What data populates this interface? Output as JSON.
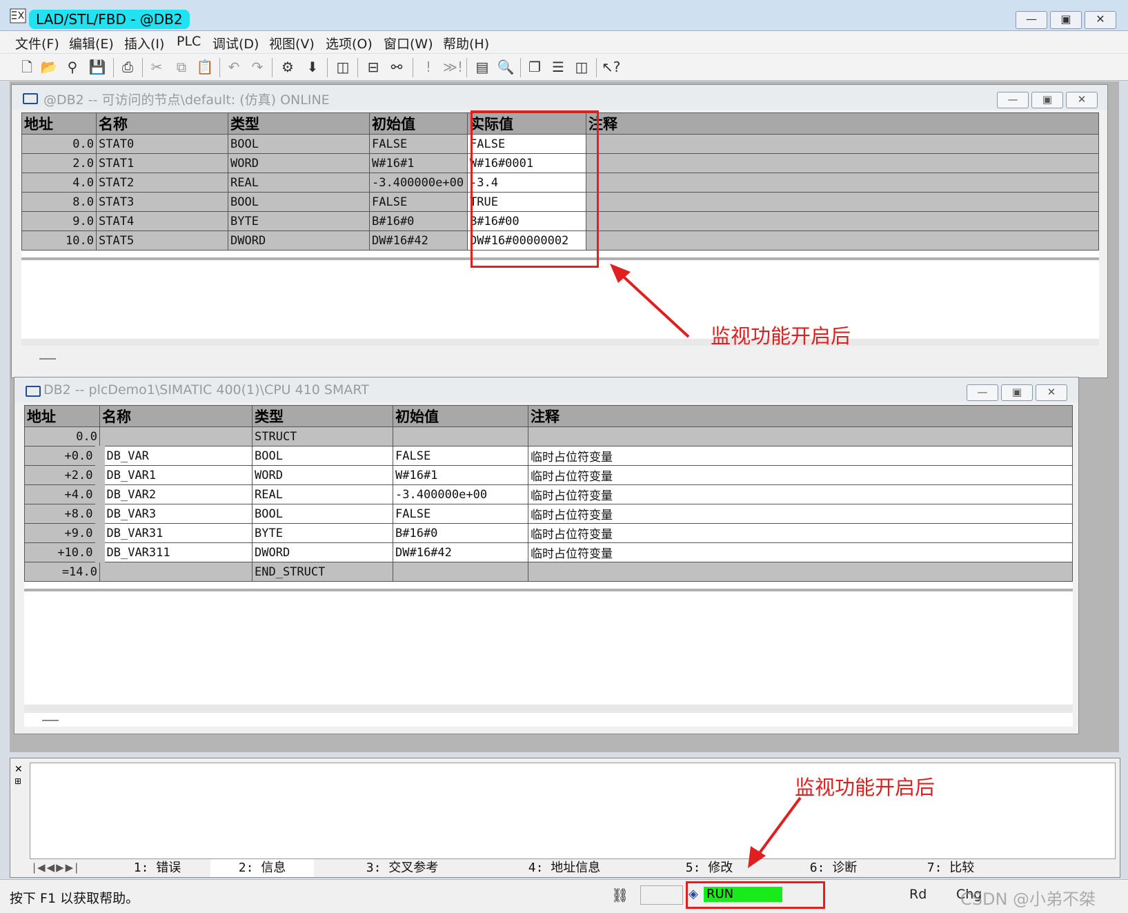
{
  "app": {
    "title": "LAD/STL/FBD  - @DB2"
  },
  "menu": [
    "文件(F)",
    "编辑(E)",
    "插入(I)",
    "PLC",
    "调试(D)",
    "视图(V)",
    "选项(O)",
    "窗口(W)",
    "帮助(H)"
  ],
  "online_window": {
    "title": "@DB2 -- 可访问的节点\\default:  (仿真)  ONLINE",
    "headers": [
      "地址",
      "名称",
      "类型",
      "初始值",
      "实际值",
      "注释"
    ],
    "rows": [
      {
        "addr": "0.0",
        "name": "STAT0",
        "type": "BOOL",
        "init": "FALSE",
        "actual": "FALSE"
      },
      {
        "addr": "2.0",
        "name": "STAT1",
        "type": "WORD",
        "init": "W#16#1",
        "actual": "W#16#0001"
      },
      {
        "addr": "4.0",
        "name": "STAT2",
        "type": "REAL",
        "init": "-3.400000e+00",
        "actual": "-3.4"
      },
      {
        "addr": "8.0",
        "name": "STAT3",
        "type": "BOOL",
        "init": "FALSE",
        "actual": "TRUE"
      },
      {
        "addr": "9.0",
        "name": "STAT4",
        "type": "BYTE",
        "init": "B#16#0",
        "actual": "B#16#00"
      },
      {
        "addr": "10.0",
        "name": "STAT5",
        "type": "DWORD",
        "init": "DW#16#42",
        "actual": "DW#16#00000002"
      }
    ]
  },
  "offline_window": {
    "title": "DB2 -- plcDemo1\\SIMATIC 400(1)\\CPU 410 SMART",
    "headers": [
      "地址",
      "名称",
      "类型",
      "初始值",
      "注释"
    ],
    "rows": [
      {
        "addr": "0.0",
        "name": "",
        "type": "STRUCT",
        "init": "",
        "comment": ""
      },
      {
        "addr": "+0.0",
        "name": "DB_VAR",
        "type": "BOOL",
        "init": "FALSE",
        "comment": "临时占位符变量"
      },
      {
        "addr": "+2.0",
        "name": "DB_VAR1",
        "type": "WORD",
        "init": "W#16#1",
        "comment": "临时占位符变量"
      },
      {
        "addr": "+4.0",
        "name": "DB_VAR2",
        "type": "REAL",
        "init": "-3.400000e+00",
        "comment": "临时占位符变量"
      },
      {
        "addr": "+8.0",
        "name": "DB_VAR3",
        "type": "BOOL",
        "init": "FALSE",
        "comment": "临时占位符变量"
      },
      {
        "addr": "+9.0",
        "name": "DB_VAR31",
        "type": "BYTE",
        "init": "B#16#0",
        "comment": "临时占位符变量"
      },
      {
        "addr": "+10.0",
        "name": "DB_VAR311",
        "type": "DWORD",
        "init": "DW#16#42",
        "comment": "临时占位符变量"
      },
      {
        "addr": "=14.0",
        "name": "",
        "type": "END_STRUCT",
        "init": "",
        "comment": ""
      }
    ]
  },
  "annotations": {
    "a1": "监视功能开启后",
    "a2": "监视功能开启后"
  },
  "output_tabs": [
    "1: 错误",
    "2: 信息",
    "3: 交叉参考",
    "4: 地址信息",
    "5: 修改",
    "6: 诊断",
    "7: 比较"
  ],
  "status": {
    "help": "按下 F1 以获取帮助。",
    "run": "RUN",
    "rd": "Rd",
    "chg": "Chg",
    "watermark": "CSDN @小弟不桀"
  },
  "colors": {
    "title_highlight": "#1fe3f2",
    "annotation": "#e02020",
    "run": "#19ea19",
    "grid_gray": "#c0c0c0"
  }
}
